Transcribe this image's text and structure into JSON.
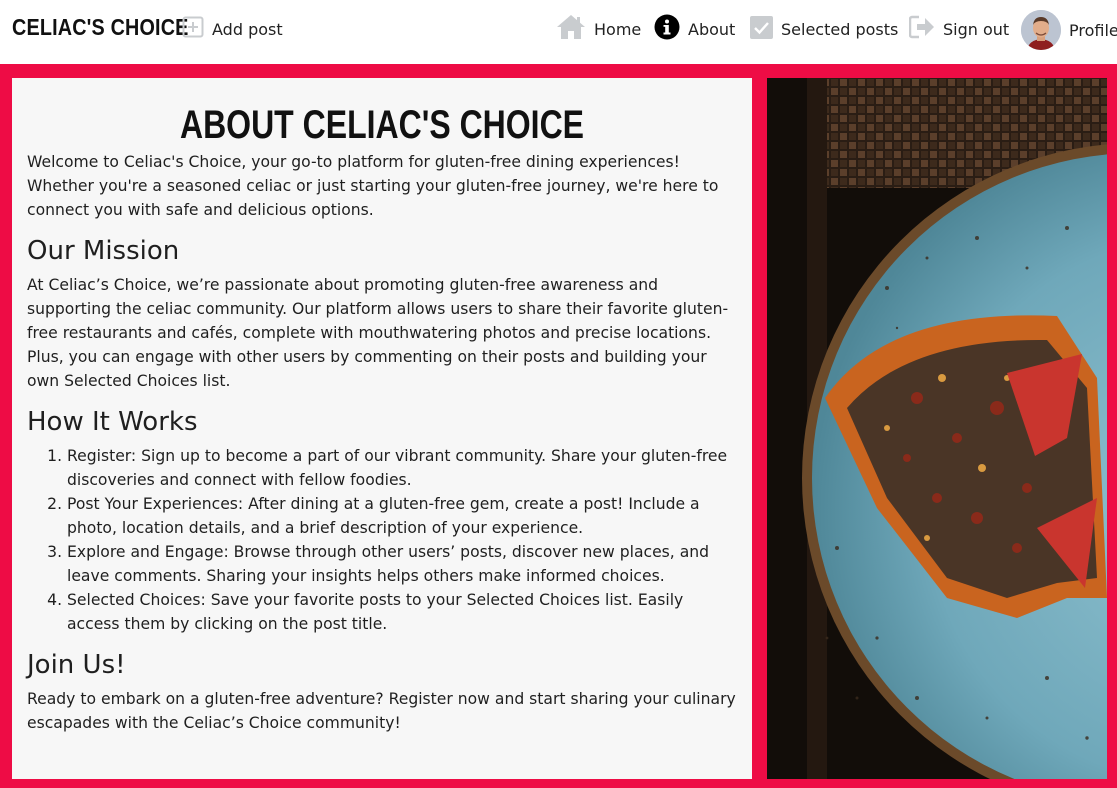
{
  "nav": {
    "brand_title": "Celiac's Choice",
    "add_post_label": "Add post",
    "home_label": "Home",
    "about_label": "About",
    "selected_label": "Selected posts",
    "signout_label": "Sign out",
    "profile_label": "Profile"
  },
  "colors": {
    "accent": "#ee0c45",
    "panel_bg": "#f7f7f7",
    "nav_icon_gray": "#c9cccf"
  },
  "icons": [
    "plus-square-icon",
    "home-icon",
    "info-circle-icon",
    "checkbox-icon",
    "sign-out-icon",
    "avatar-image"
  ],
  "about": {
    "title": "About Celiac's Choice",
    "intro": "Welcome to Celiac's Choice, your go-to platform for gluten-free dining experiences! Whether you're a seasoned celiac or just starting your gluten-free journey, we're here to connect you with safe and delicious options.",
    "mission_heading": "Our Mission",
    "mission_text": "At Celiac’s Choice, we’re passionate about promoting gluten-free awareness and supporting the celiac community. Our platform allows users to share their favorite gluten-free restaurants and cafés, complete with mouthwatering photos and precise locations. Plus, you can engage with other users by commenting on their posts and building your own Selected Choices list.",
    "how_heading": "How It Works",
    "steps": [
      "Register: Sign up to become a part of our vibrant community. Share your gluten-free discoveries and connect with fellow foodies.",
      "Post Your Experiences: After dining at a gluten-free gem, create a post! Include a photo, location details, and a brief description of your experience.",
      "Explore and Engage: Browse through other users’ posts, discover new places, and leave comments. Sharing your insights helps others make informed choices.",
      "Selected Choices: Save your favorite posts to your Selected Choices list. Easily access them by clicking on the post title."
    ],
    "join_heading": "Join Us!",
    "join_text": "Ready to embark on a gluten-free adventure? Register now and start sharing your culinary escapades with the Celiac’s Choice community!"
  }
}
